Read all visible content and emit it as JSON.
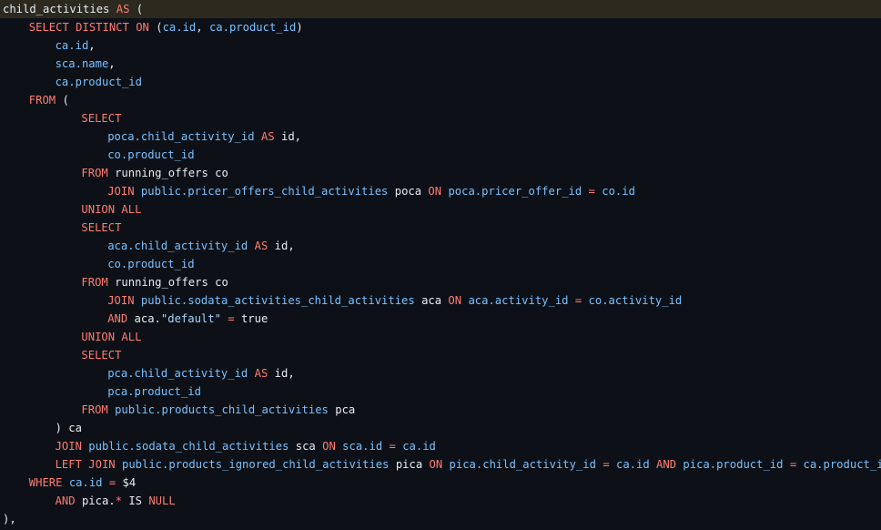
{
  "editor": {
    "colors": {
      "background": "#0d1117",
      "current_line": "#2c2a1f",
      "keyword": "#ff7b72",
      "identifier": "#79c0ff",
      "plain": "#e6edf3",
      "string": "#a5d6ff"
    },
    "lines": [
      {
        "indent": 0,
        "tokens": [
          {
            "t": "child_activities ",
            "c": "pl"
          },
          {
            "t": "AS",
            "c": "kw"
          },
          {
            "t": " (",
            "c": "pl"
          }
        ]
      },
      {
        "indent": 1,
        "tokens": [
          {
            "t": "SELECT DISTINCT ON",
            "c": "kw"
          },
          {
            "t": " (",
            "c": "pl"
          },
          {
            "t": "ca.id",
            "c": "id"
          },
          {
            "t": ", ",
            "c": "pl"
          },
          {
            "t": "ca.product_id",
            "c": "id"
          },
          {
            "t": ")",
            "c": "pl"
          }
        ]
      },
      {
        "indent": 2,
        "tokens": [
          {
            "t": "ca.id",
            "c": "id"
          },
          {
            "t": ",",
            "c": "pl"
          }
        ]
      },
      {
        "indent": 2,
        "tokens": [
          {
            "t": "sca.name",
            "c": "id"
          },
          {
            "t": ",",
            "c": "pl"
          }
        ]
      },
      {
        "indent": 2,
        "tokens": [
          {
            "t": "ca.product_id",
            "c": "id"
          }
        ]
      },
      {
        "indent": 1,
        "tokens": [
          {
            "t": "FROM",
            "c": "kw"
          },
          {
            "t": " (",
            "c": "pl"
          }
        ]
      },
      {
        "indent": 3,
        "tokens": [
          {
            "t": "SELECT",
            "c": "kw"
          }
        ]
      },
      {
        "indent": 4,
        "tokens": [
          {
            "t": "poca.child_activity_id",
            "c": "id"
          },
          {
            "t": " ",
            "c": "pl"
          },
          {
            "t": "AS",
            "c": "kw"
          },
          {
            "t": " id,",
            "c": "pl"
          }
        ]
      },
      {
        "indent": 4,
        "tokens": [
          {
            "t": "co.product_id",
            "c": "id"
          }
        ]
      },
      {
        "indent": 3,
        "tokens": [
          {
            "t": "FROM",
            "c": "kw"
          },
          {
            "t": " running_offers co",
            "c": "pl"
          }
        ]
      },
      {
        "indent": 4,
        "tokens": [
          {
            "t": "JOIN",
            "c": "kw"
          },
          {
            "t": " ",
            "c": "pl"
          },
          {
            "t": "public.pricer_offers_child_activities",
            "c": "id"
          },
          {
            "t": " poca ",
            "c": "pl"
          },
          {
            "t": "ON",
            "c": "kw"
          },
          {
            "t": " ",
            "c": "pl"
          },
          {
            "t": "poca.pricer_offer_id",
            "c": "id"
          },
          {
            "t": " ",
            "c": "pl"
          },
          {
            "t": "=",
            "c": "kw"
          },
          {
            "t": " ",
            "c": "pl"
          },
          {
            "t": "co.id",
            "c": "id"
          }
        ]
      },
      {
        "indent": 3,
        "tokens": [
          {
            "t": "UNION ALL",
            "c": "kw"
          }
        ]
      },
      {
        "indent": 3,
        "tokens": [
          {
            "t": "SELECT",
            "c": "kw"
          }
        ]
      },
      {
        "indent": 4,
        "tokens": [
          {
            "t": "aca.child_activity_id",
            "c": "id"
          },
          {
            "t": " ",
            "c": "pl"
          },
          {
            "t": "AS",
            "c": "kw"
          },
          {
            "t": " id,",
            "c": "pl"
          }
        ]
      },
      {
        "indent": 4,
        "tokens": [
          {
            "t": "co.product_id",
            "c": "id"
          }
        ]
      },
      {
        "indent": 3,
        "tokens": [
          {
            "t": "FROM",
            "c": "kw"
          },
          {
            "t": " running_offers co",
            "c": "pl"
          }
        ]
      },
      {
        "indent": 4,
        "tokens": [
          {
            "t": "JOIN",
            "c": "kw"
          },
          {
            "t": " ",
            "c": "pl"
          },
          {
            "t": "public.sodata_activities_child_activities",
            "c": "id"
          },
          {
            "t": " aca ",
            "c": "pl"
          },
          {
            "t": "ON",
            "c": "kw"
          },
          {
            "t": " ",
            "c": "pl"
          },
          {
            "t": "aca.activity_id",
            "c": "id"
          },
          {
            "t": " ",
            "c": "pl"
          },
          {
            "t": "=",
            "c": "kw"
          },
          {
            "t": " ",
            "c": "pl"
          },
          {
            "t": "co.activity_id",
            "c": "id"
          }
        ]
      },
      {
        "indent": 4,
        "tokens": [
          {
            "t": "AND",
            "c": "kw"
          },
          {
            "t": " aca.",
            "c": "pl"
          },
          {
            "t": "\"default\"",
            "c": "st"
          },
          {
            "t": " ",
            "c": "pl"
          },
          {
            "t": "=",
            "c": "kw"
          },
          {
            "t": " true",
            "c": "pl"
          }
        ]
      },
      {
        "indent": 3,
        "tokens": [
          {
            "t": "UNION ALL",
            "c": "kw"
          }
        ]
      },
      {
        "indent": 3,
        "tokens": [
          {
            "t": "SELECT",
            "c": "kw"
          }
        ]
      },
      {
        "indent": 4,
        "tokens": [
          {
            "t": "pca.child_activity_id",
            "c": "id"
          },
          {
            "t": " ",
            "c": "pl"
          },
          {
            "t": "AS",
            "c": "kw"
          },
          {
            "t": " id,",
            "c": "pl"
          }
        ]
      },
      {
        "indent": 4,
        "tokens": [
          {
            "t": "pca.product_id",
            "c": "id"
          }
        ]
      },
      {
        "indent": 3,
        "tokens": [
          {
            "t": "FROM",
            "c": "kw"
          },
          {
            "t": " ",
            "c": "pl"
          },
          {
            "t": "public.products_child_activities",
            "c": "id"
          },
          {
            "t": " pca",
            "c": "pl"
          }
        ]
      },
      {
        "indent": 2,
        "tokens": [
          {
            "t": ") ca",
            "c": "pl"
          }
        ]
      },
      {
        "indent": 2,
        "tokens": [
          {
            "t": "JOIN",
            "c": "kw"
          },
          {
            "t": " ",
            "c": "pl"
          },
          {
            "t": "public.sodata_child_activities",
            "c": "id"
          },
          {
            "t": " sca ",
            "c": "pl"
          },
          {
            "t": "ON",
            "c": "kw"
          },
          {
            "t": " ",
            "c": "pl"
          },
          {
            "t": "sca.id",
            "c": "id"
          },
          {
            "t": " ",
            "c": "pl"
          },
          {
            "t": "=",
            "c": "kw"
          },
          {
            "t": " ",
            "c": "pl"
          },
          {
            "t": "ca.id",
            "c": "id"
          }
        ]
      },
      {
        "indent": 2,
        "tokens": [
          {
            "t": "LEFT JOIN",
            "c": "kw"
          },
          {
            "t": " ",
            "c": "pl"
          },
          {
            "t": "public.products_ignored_child_activities",
            "c": "id"
          },
          {
            "t": " pica ",
            "c": "pl"
          },
          {
            "t": "ON",
            "c": "kw"
          },
          {
            "t": " ",
            "c": "pl"
          },
          {
            "t": "pica.child_activity_id",
            "c": "id"
          },
          {
            "t": " ",
            "c": "pl"
          },
          {
            "t": "=",
            "c": "kw"
          },
          {
            "t": " ",
            "c": "pl"
          },
          {
            "t": "ca.id",
            "c": "id"
          },
          {
            "t": " ",
            "c": "pl"
          },
          {
            "t": "AND",
            "c": "kw"
          },
          {
            "t": " ",
            "c": "pl"
          },
          {
            "t": "pica.product_id",
            "c": "id"
          },
          {
            "t": " ",
            "c": "pl"
          },
          {
            "t": "=",
            "c": "kw"
          },
          {
            "t": " ",
            "c": "pl"
          },
          {
            "t": "ca.product_id",
            "c": "id"
          }
        ]
      },
      {
        "indent": 1,
        "tokens": [
          {
            "t": "WHERE",
            "c": "kw"
          },
          {
            "t": " ",
            "c": "pl"
          },
          {
            "t": "ca.id",
            "c": "id"
          },
          {
            "t": " ",
            "c": "pl"
          },
          {
            "t": "=",
            "c": "kw"
          },
          {
            "t": " $4",
            "c": "pl"
          }
        ]
      },
      {
        "indent": 2,
        "tokens": [
          {
            "t": "AND",
            "c": "kw"
          },
          {
            "t": " pica.",
            "c": "pl"
          },
          {
            "t": "*",
            "c": "kw"
          },
          {
            "t": " IS ",
            "c": "pl"
          },
          {
            "t": "NULL",
            "c": "kw"
          }
        ]
      },
      {
        "indent": 0,
        "tokens": [
          {
            "t": "),",
            "c": "pl"
          }
        ]
      }
    ]
  }
}
